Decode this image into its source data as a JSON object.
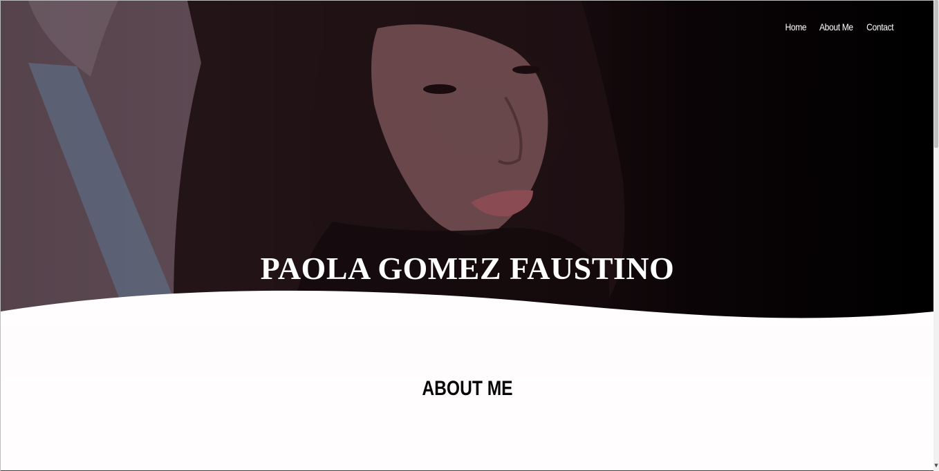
{
  "nav": {
    "items": [
      {
        "label": "Home"
      },
      {
        "label": "About Me"
      },
      {
        "label": "Contact"
      }
    ]
  },
  "hero": {
    "title": "PAOLA GOMEZ FAUSTINO"
  },
  "about": {
    "heading": "ABOUT ME"
  },
  "icons": {
    "scroll_down": "scroll-down-arrow-icon"
  },
  "colors": {
    "hero_overlay": "#000000",
    "hero_text": "#ffffff",
    "heading_text": "#050505",
    "page_background": "#fffdfd"
  }
}
